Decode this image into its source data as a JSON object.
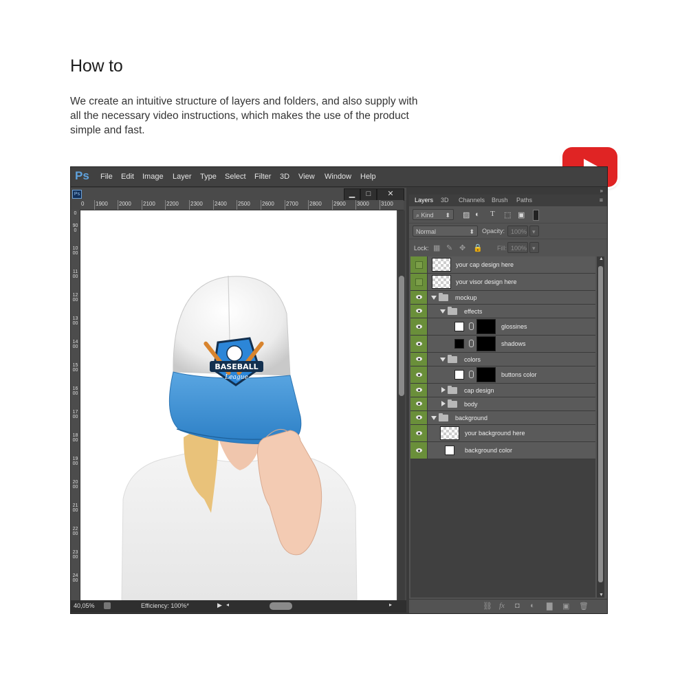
{
  "page": {
    "heading": "How to",
    "intro": "We create an intuitive structure of layers and folders, and also supply with all the necessary video instructions, which makes the use of the product simple and fast."
  },
  "youtube": {
    "icon": "youtube-play-icon",
    "color": "#e02424"
  },
  "app": {
    "logo": "Ps",
    "menu": [
      "File",
      "Edit",
      "Image",
      "Layer",
      "Type",
      "Select",
      "Filter",
      "3D",
      "View",
      "Window",
      "Help"
    ]
  },
  "document": {
    "doc_badge": "Ps",
    "window_buttons": [
      "▁",
      "□",
      "✕"
    ],
    "ruler_top": [
      "0",
      "1900",
      "2000",
      "2100",
      "2200",
      "2300",
      "2400",
      "2500",
      "2600",
      "2700",
      "2800",
      "2900",
      "3000",
      "3100"
    ],
    "ruler_left": [
      "0",
      "900",
      "1000",
      "1100",
      "1200",
      "1300",
      "1400",
      "1500",
      "1600",
      "1700",
      "1800",
      "1900",
      "2000",
      "2100",
      "2200",
      "2300",
      "2400"
    ],
    "badge_line1": "BASEBALL",
    "badge_line2": "League",
    "zoom": "40,05%",
    "efficiency": "Efficiency: 100%*"
  },
  "layers_panel": {
    "expand_glyph": "»",
    "menu_glyph": "≡",
    "tabs": [
      "Layers",
      "3D",
      "Channels",
      "Brush",
      "Paths"
    ],
    "active_tab": "Layers",
    "kind_label": "Kind",
    "blend_mode": "Normal",
    "opacity_label": "Opacity:",
    "opacity_value": "100%",
    "lock_label": "Lock:",
    "fill_label": "Fill:",
    "fill_value": "100%",
    "layers": [
      {
        "name": "your cap design here",
        "type": "smart",
        "visible": false,
        "depth": 0
      },
      {
        "name": "your visor design here",
        "type": "smart",
        "visible": false,
        "depth": 0
      },
      {
        "name": "mockup",
        "type": "folder",
        "expanded": true,
        "visible": true,
        "depth": 0
      },
      {
        "name": "effects",
        "type": "folder",
        "expanded": true,
        "visible": true,
        "depth": 1
      },
      {
        "name": "glossines",
        "type": "masked",
        "visible": true,
        "depth": 2
      },
      {
        "name": "shadows",
        "type": "masked",
        "visible": true,
        "depth": 2
      },
      {
        "name": "colors",
        "type": "folder",
        "expanded": true,
        "visible": true,
        "depth": 1
      },
      {
        "name": "buttons color",
        "type": "masked",
        "visible": true,
        "depth": 2
      },
      {
        "name": "cap design",
        "type": "folder",
        "expanded": false,
        "visible": true,
        "depth": 1
      },
      {
        "name": "body",
        "type": "folder",
        "expanded": false,
        "visible": true,
        "depth": 1
      },
      {
        "name": "background",
        "type": "folder",
        "expanded": true,
        "visible": true,
        "depth": 0
      },
      {
        "name": "your background here",
        "type": "pixel",
        "visible": true,
        "depth": 1
      },
      {
        "name": "background color",
        "type": "fill",
        "visible": true,
        "depth": 1
      }
    ],
    "footer_icons": [
      "link-icon",
      "fx-icon",
      "mask-icon",
      "adjustment-icon",
      "new-group-icon",
      "new-layer-icon",
      "trash-icon"
    ],
    "footer_glyphs": [
      "⛓",
      "fx",
      "◘",
      "◐",
      "▇",
      "▣",
      "🗑"
    ]
  },
  "colors": {
    "visor_blue": "#3b8fd4",
    "layer_eye_green": "#6a8f3a",
    "ps_blue": "#5fa2dd"
  }
}
